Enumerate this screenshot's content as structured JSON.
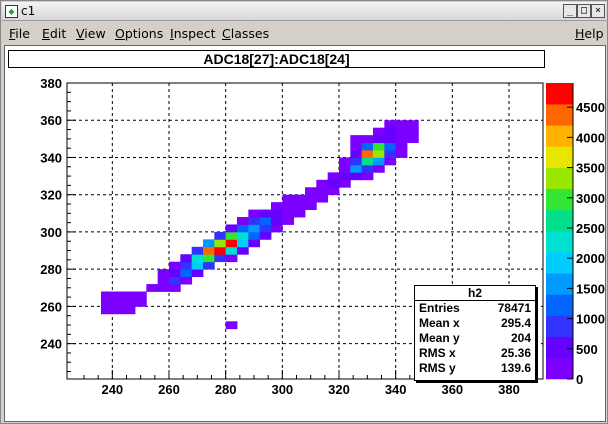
{
  "window": {
    "title": "c1",
    "app_icon": "root-canvas-icon",
    "buttons": [
      "_",
      "□",
      "×"
    ]
  },
  "menubar": {
    "items": [
      {
        "pre": "",
        "ul": "F",
        "post": "ile"
      },
      {
        "pre": "",
        "ul": "E",
        "post": "dit"
      },
      {
        "pre": "",
        "ul": "V",
        "post": "iew"
      },
      {
        "pre": "",
        "ul": "O",
        "post": "ptions"
      },
      {
        "pre": "",
        "ul": "I",
        "post": "nspect"
      },
      {
        "pre": "",
        "ul": "C",
        "post": "lasses"
      },
      {
        "pre": "",
        "ul": "H",
        "post": "elp"
      }
    ]
  },
  "plot_title": "ADC18[27]:ADC18[24]",
  "stats": {
    "name": "h2",
    "rows": [
      {
        "label": "Entries",
        "value": "78471"
      },
      {
        "label": "Mean x",
        "value": "295.4"
      },
      {
        "label": "Mean y",
        "value": "204"
      },
      {
        "label": "RMS x",
        "value": "25.36"
      },
      {
        "label": "RMS y",
        "value": "139.6"
      }
    ]
  },
  "chart_data": {
    "type": "heatmap",
    "title": "ADC18[27]:ADC18[24]",
    "xlim": [
      224,
      392
    ],
    "ylim": [
      221,
      380
    ],
    "x_ticks": [
      240,
      260,
      280,
      300,
      320,
      340,
      360,
      380
    ],
    "y_ticks": [
      240,
      260,
      280,
      300,
      320,
      340,
      360,
      380
    ],
    "grid": true,
    "colorbar": {
      "ticks": [
        "0",
        "500",
        "1000",
        "1500",
        "2000",
        "2500",
        "3000",
        "3500",
        "4000",
        "4500"
      ],
      "max": 4900,
      "colors": [
        "#7b00ff",
        "#6600ff",
        "#3333ff",
        "#0066ff",
        "#0099ff",
        "#00ccff",
        "#00e0d0",
        "#00e08a",
        "#33e633",
        "#99e600",
        "#e6e600",
        "#ffb300",
        "#ff6600",
        "#ff0000"
      ]
    },
    "bin_size": [
      4,
      4
    ],
    "bins": [
      {
        "x": 236,
        "y": 256,
        "v": 150
      },
      {
        "x": 240,
        "y": 256,
        "v": 150
      },
      {
        "x": 244,
        "y": 256,
        "v": 150
      },
      {
        "x": 236,
        "y": 260,
        "v": 150
      },
      {
        "x": 240,
        "y": 260,
        "v": 150
      },
      {
        "x": 244,
        "y": 260,
        "v": 150
      },
      {
        "x": 248,
        "y": 260,
        "v": 150
      },
      {
        "x": 236,
        "y": 264,
        "v": 150
      },
      {
        "x": 240,
        "y": 264,
        "v": 150
      },
      {
        "x": 244,
        "y": 264,
        "v": 150
      },
      {
        "x": 248,
        "y": 264,
        "v": 150
      },
      {
        "x": 252,
        "y": 268,
        "v": 150
      },
      {
        "x": 256,
        "y": 268,
        "v": 250
      },
      {
        "x": 260,
        "y": 268,
        "v": 150
      },
      {
        "x": 256,
        "y": 272,
        "v": 300
      },
      {
        "x": 260,
        "y": 272,
        "v": 900
      },
      {
        "x": 264,
        "y": 272,
        "v": 300
      },
      {
        "x": 260,
        "y": 276,
        "v": 500
      },
      {
        "x": 264,
        "y": 276,
        "v": 1200
      },
      {
        "x": 268,
        "y": 276,
        "v": 500
      },
      {
        "x": 256,
        "y": 276,
        "v": 200
      },
      {
        "x": 264,
        "y": 280,
        "v": 900
      },
      {
        "x": 268,
        "y": 280,
        "v": 1800
      },
      {
        "x": 272,
        "y": 280,
        "v": 700
      },
      {
        "x": 260,
        "y": 280,
        "v": 300
      },
      {
        "x": 264,
        "y": 284,
        "v": 500
      },
      {
        "x": 268,
        "y": 284,
        "v": 2200
      },
      {
        "x": 272,
        "y": 284,
        "v": 2800
      },
      {
        "x": 276,
        "y": 284,
        "v": 900
      },
      {
        "x": 280,
        "y": 284,
        "v": 300
      },
      {
        "x": 268,
        "y": 288,
        "v": 900
      },
      {
        "x": 272,
        "y": 288,
        "v": 4200
      },
      {
        "x": 276,
        "y": 288,
        "v": 4900
      },
      {
        "x": 280,
        "y": 288,
        "v": 2400
      },
      {
        "x": 284,
        "y": 288,
        "v": 600
      },
      {
        "x": 272,
        "y": 292,
        "v": 1600
      },
      {
        "x": 276,
        "y": 292,
        "v": 3400
      },
      {
        "x": 280,
        "y": 292,
        "v": 4600
      },
      {
        "x": 284,
        "y": 292,
        "v": 1800
      },
      {
        "x": 288,
        "y": 292,
        "v": 500
      },
      {
        "x": 276,
        "y": 296,
        "v": 900
      },
      {
        "x": 280,
        "y": 296,
        "v": 2800
      },
      {
        "x": 284,
        "y": 296,
        "v": 2200
      },
      {
        "x": 288,
        "y": 296,
        "v": 1200
      },
      {
        "x": 292,
        "y": 296,
        "v": 400
      },
      {
        "x": 280,
        "y": 300,
        "v": 500
      },
      {
        "x": 284,
        "y": 300,
        "v": 1200
      },
      {
        "x": 288,
        "y": 300,
        "v": 1600
      },
      {
        "x": 292,
        "y": 300,
        "v": 900
      },
      {
        "x": 296,
        "y": 300,
        "v": 300
      },
      {
        "x": 284,
        "y": 304,
        "v": 300
      },
      {
        "x": 288,
        "y": 304,
        "v": 700
      },
      {
        "x": 292,
        "y": 304,
        "v": 1100
      },
      {
        "x": 296,
        "y": 304,
        "v": 500
      },
      {
        "x": 300,
        "y": 304,
        "v": 200
      },
      {
        "x": 288,
        "y": 308,
        "v": 200
      },
      {
        "x": 292,
        "y": 308,
        "v": 400
      },
      {
        "x": 296,
        "y": 308,
        "v": 500
      },
      {
        "x": 300,
        "y": 308,
        "v": 300
      },
      {
        "x": 304,
        "y": 308,
        "v": 150
      },
      {
        "x": 296,
        "y": 312,
        "v": 200
      },
      {
        "x": 300,
        "y": 312,
        "v": 300
      },
      {
        "x": 304,
        "y": 312,
        "v": 250
      },
      {
        "x": 308,
        "y": 312,
        "v": 150
      },
      {
        "x": 300,
        "y": 316,
        "v": 150
      },
      {
        "x": 304,
        "y": 316,
        "v": 200
      },
      {
        "x": 308,
        "y": 316,
        "v": 250
      },
      {
        "x": 312,
        "y": 316,
        "v": 150
      },
      {
        "x": 308,
        "y": 320,
        "v": 200
      },
      {
        "x": 312,
        "y": 320,
        "v": 300
      },
      {
        "x": 316,
        "y": 320,
        "v": 200
      },
      {
        "x": 312,
        "y": 324,
        "v": 200
      },
      {
        "x": 316,
        "y": 324,
        "v": 350
      },
      {
        "x": 320,
        "y": 324,
        "v": 250
      },
      {
        "x": 316,
        "y": 328,
        "v": 250
      },
      {
        "x": 320,
        "y": 328,
        "v": 500
      },
      {
        "x": 324,
        "y": 328,
        "v": 500
      },
      {
        "x": 328,
        "y": 328,
        "v": 200
      },
      {
        "x": 320,
        "y": 332,
        "v": 300
      },
      {
        "x": 324,
        "y": 332,
        "v": 1400
      },
      {
        "x": 328,
        "y": 332,
        "v": 900
      },
      {
        "x": 332,
        "y": 332,
        "v": 300
      },
      {
        "x": 320,
        "y": 336,
        "v": 200
      },
      {
        "x": 324,
        "y": 336,
        "v": 900
      },
      {
        "x": 328,
        "y": 336,
        "v": 2600
      },
      {
        "x": 332,
        "y": 336,
        "v": 1700
      },
      {
        "x": 336,
        "y": 336,
        "v": 300
      },
      {
        "x": 324,
        "y": 340,
        "v": 500
      },
      {
        "x": 328,
        "y": 340,
        "v": 4400
      },
      {
        "x": 332,
        "y": 340,
        "v": 3400
      },
      {
        "x": 336,
        "y": 340,
        "v": 800
      },
      {
        "x": 340,
        "y": 340,
        "v": 200
      },
      {
        "x": 324,
        "y": 344,
        "v": 300
      },
      {
        "x": 328,
        "y": 344,
        "v": 1200
      },
      {
        "x": 332,
        "y": 344,
        "v": 2800
      },
      {
        "x": 336,
        "y": 344,
        "v": 1200
      },
      {
        "x": 340,
        "y": 344,
        "v": 300
      },
      {
        "x": 324,
        "y": 348,
        "v": 150
      },
      {
        "x": 328,
        "y": 348,
        "v": 300
      },
      {
        "x": 332,
        "y": 348,
        "v": 600
      },
      {
        "x": 336,
        "y": 348,
        "v": 400
      },
      {
        "x": 340,
        "y": 348,
        "v": 200
      },
      {
        "x": 344,
        "y": 348,
        "v": 150
      },
      {
        "x": 332,
        "y": 352,
        "v": 200
      },
      {
        "x": 336,
        "y": 352,
        "v": 400
      },
      {
        "x": 340,
        "y": 352,
        "v": 200
      },
      {
        "x": 344,
        "y": 352,
        "v": 150
      },
      {
        "x": 336,
        "y": 356,
        "v": 150
      },
      {
        "x": 340,
        "y": 356,
        "v": 150
      },
      {
        "x": 344,
        "y": 356,
        "v": 150
      },
      {
        "x": 280,
        "y": 248,
        "v": 150
      }
    ]
  }
}
